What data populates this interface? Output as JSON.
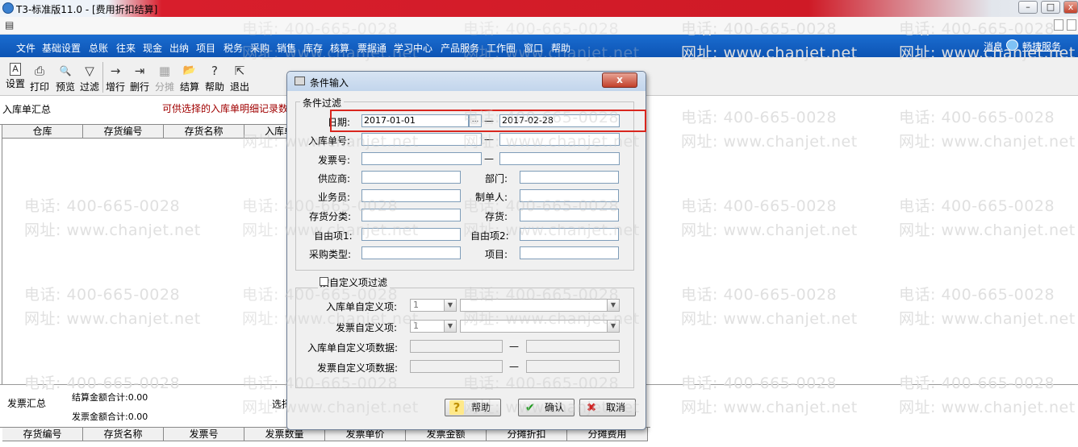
{
  "window": {
    "title": "T3-标准版11.0 - [费用折扣结算]"
  },
  "menu": [
    "文件",
    "基础设置",
    "总账",
    "往来",
    "现金",
    "出纳",
    "项目",
    "税务",
    "采购",
    "销售",
    "库存",
    "核算",
    "票据通",
    "学习中心",
    "产品服务",
    "工作圈",
    "窗口",
    "帮助"
  ],
  "menu_right": {
    "messages": "消息",
    "quick_service": "畅捷服务"
  },
  "toolbar": [
    {
      "label": "设置",
      "icon": "A"
    },
    {
      "label": "打印",
      "icon": "⎙"
    },
    {
      "label": "预览",
      "icon": "🔍"
    },
    {
      "label": "过滤",
      "icon": "▽"
    },
    {
      "label": "增行",
      "icon": "→"
    },
    {
      "label": "删行",
      "icon": "⇥"
    },
    {
      "label": "分摊",
      "icon": "▦",
      "disabled": true
    },
    {
      "label": "结算",
      "icon": "📂"
    },
    {
      "label": "帮助",
      "icon": "?"
    },
    {
      "label": "退出",
      "icon": "⇱"
    }
  ],
  "inbound": {
    "section_label": "入库单汇总",
    "hint": "可供选择的入库单明细记录数",
    "columns": [
      "仓库",
      "存货编号",
      "存货名称",
      "入库单"
    ]
  },
  "invoice": {
    "section_label": "发票汇总",
    "settle_total": "结算金额合计:0.00",
    "invoice_total": "发票金额合计:0.00",
    "select_label": "选择",
    "columns": [
      "存货编号",
      "存货名称",
      "发票号",
      "发票数量",
      "发票单价",
      "发票金额",
      "分摊折扣",
      "分摊费用"
    ]
  },
  "watermark": {
    "phone": "电话: 400-665-0028",
    "site": "网址: www.chanjet.net"
  },
  "dialog": {
    "title": "条件输入",
    "close": "x",
    "filter_group": "条件过滤",
    "date_label": "日期:",
    "date_from": "2017-01-01",
    "date_to": "2017-02-28",
    "date_btn": "...",
    "dash": "—",
    "inbound_no_label": "入库单号:",
    "invoice_no_label": "发票号:",
    "supplier_label": "供应商:",
    "dept_label": "部门:",
    "salesman_label": "业务员:",
    "creator_label": "制单人:",
    "inv_class_label": "存货分类:",
    "inventory_label": "存货:",
    "free1_label": "自由项1:",
    "free2_label": "自由项2:",
    "purchase_type_label": "采购类型:",
    "project_label": "项目:",
    "custom_group": "按自定义项过滤",
    "inbound_custom_label": "入库单自定义项:",
    "inbound_custom_value": "1",
    "invoice_custom_label": "发票自定义项:",
    "invoice_custom_value": "1",
    "inbound_custom_data_label": "入库单自定义项数据:",
    "invoice_custom_data_label": "发票自定义项数据:",
    "help_btn": "帮助",
    "ok_btn": "确认",
    "cancel_btn": "取消"
  }
}
